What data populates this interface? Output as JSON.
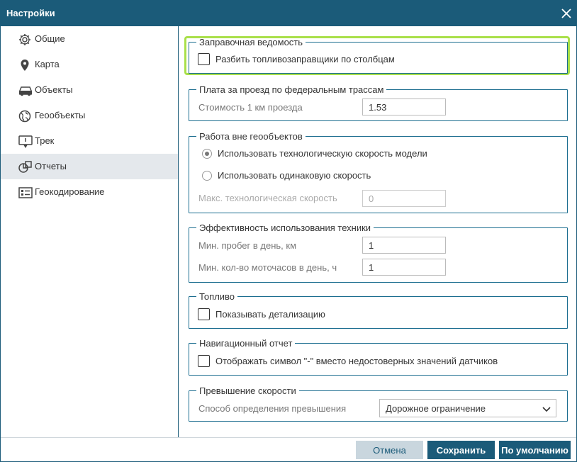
{
  "window": {
    "title": "Настройки",
    "close_icon": "close-icon"
  },
  "sidebar": {
    "items": [
      {
        "label": "Общие",
        "icon": "gear-icon"
      },
      {
        "label": "Карта",
        "icon": "map-pin-icon"
      },
      {
        "label": "Объекты",
        "icon": "car-icon"
      },
      {
        "label": "Геообъекты",
        "icon": "globe-icon"
      },
      {
        "label": "Трек",
        "icon": "track-icon"
      },
      {
        "label": "Отчеты",
        "icon": "pie-chart-icon",
        "active": true
      },
      {
        "label": "Геокодирование",
        "icon": "address-card-icon"
      }
    ]
  },
  "sections": {
    "fuel_sheet": {
      "legend": "Заправочная ведомость",
      "checkbox_label": "Разбить топливозаправщики по столбцам",
      "checked": false
    },
    "toll": {
      "legend": "Плата за проезд по федеральным трассам",
      "cost_label": "Стоимость 1 км проезда",
      "cost_value": "1.53"
    },
    "outside_geo": {
      "legend": "Работа вне геообъектов",
      "radio1": "Использовать технологическую скорость модели",
      "radio2": "Использовать одинаковую скорость",
      "selected": 1,
      "max_speed_label": "Макс. технологическая скорость",
      "max_speed_value": "0"
    },
    "efficiency": {
      "legend": "Эффективность использования техники",
      "mileage_label": "Мин. пробег в день, км",
      "mileage_value": "1",
      "hours_label": "Мин. кол-во моточасов в день, ч",
      "hours_value": "1"
    },
    "fuel": {
      "legend": "Топливо",
      "checkbox_label": "Показывать детализацию",
      "checked": false
    },
    "nav_report": {
      "legend": "Навигационный отчет",
      "checkbox_label": "Отображать символ \"-\" вместо недостоверных значений датчиков",
      "checked": false
    },
    "speeding": {
      "legend": "Превышение скорости",
      "method_label": "Способ определения превышения",
      "method_value": "Дорожное ограничение"
    }
  },
  "footer": {
    "cancel": "Отмена",
    "save": "Сохранить",
    "default": "По умолчанию"
  },
  "colors": {
    "header": "#1b5b79",
    "highlight": "#a9e04a",
    "active_item": "#e4e8ec"
  }
}
